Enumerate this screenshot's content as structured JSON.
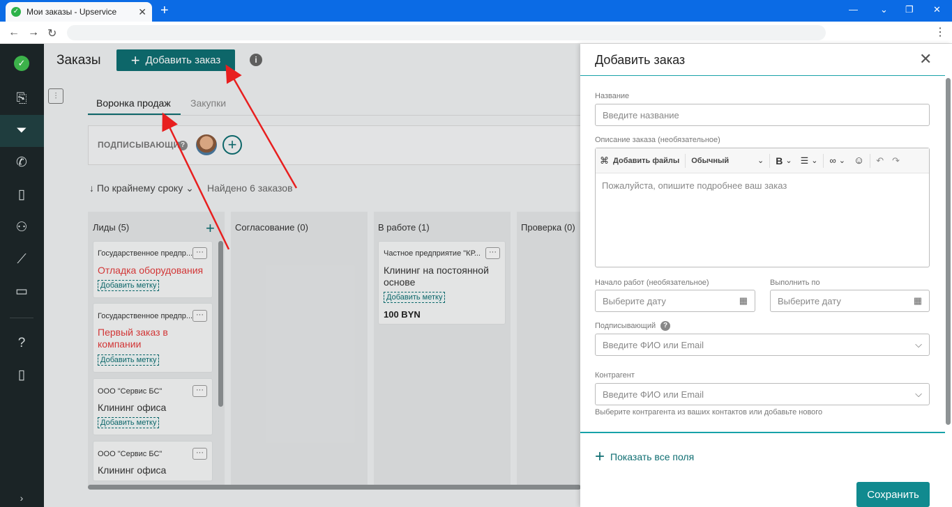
{
  "browser": {
    "tab_title": "Мои заказы - Upservice",
    "tab_close": "✕",
    "new_tab": "+",
    "minimize": "—",
    "maximize": "❐",
    "close": "✕",
    "back": "←",
    "forward": "→",
    "reload": "↻",
    "menu": "⋮"
  },
  "sidebar": {
    "icons": [
      "logo-icon",
      "clipboard-icon",
      "funnel-icon",
      "phone-icon",
      "book-icon",
      "users-icon",
      "chart-icon",
      "folder-icon",
      "help-icon",
      "tablet-icon",
      "expand-icon"
    ]
  },
  "header": {
    "title": "Заказы",
    "add_button": "Добавить заказ",
    "add_plus": "+",
    "info": "i"
  },
  "tabs": [
    {
      "label": "Воронка продаж",
      "active": true
    },
    {
      "label": "Закупки",
      "active": false
    }
  ],
  "signers": {
    "label": "ПОДПИСЫВАЮЩИЕ",
    "help": "?",
    "add": "+"
  },
  "sort": {
    "label": "По крайнему сроку",
    "icon": "↓",
    "chevron": "⌄"
  },
  "found": "Найдено 6 заказов",
  "columns": [
    {
      "title": "Лиды (5)",
      "add": "+"
    },
    {
      "title": "Согласование (0)"
    },
    {
      "title": "В работе (1)"
    },
    {
      "title": "Проверка (0)"
    }
  ],
  "cards": [
    {
      "org": "Государственное предпр...",
      "title": "Отладка оборудования",
      "tag": "Добавить метку",
      "dots": "···"
    },
    {
      "org": "Государственное предпр...",
      "title": "Первый заказ в компании",
      "tag": "Добавить метку",
      "dots": "···"
    },
    {
      "org": "ООО \"Сервис БС\"",
      "title": "Клининг офиса",
      "tag": "Добавить метку",
      "dots": "···"
    },
    {
      "org": "ООО \"Сервис БС\"",
      "title": "Клининг офиса",
      "tag": "",
      "dots": "···"
    },
    {
      "org": "Частное предприятие \"КР...",
      "title": "Клининг на постоянной основе",
      "tag": "Добавить метку",
      "price": "100 BYN",
      "dots": "···"
    }
  ],
  "drawer": {
    "title": "Добавить заказ",
    "close": "✕",
    "name_label": "Название",
    "name_placeholder": "Введите название",
    "desc_label": "Описание заказа (необязательное)",
    "toolbar": {
      "attach": "Добавить файлы",
      "style": "Обычный",
      "bold": "B",
      "chevron": "⌄",
      "list": "☰",
      "link": "🔗",
      "emoji": "☺",
      "undo": "↶",
      "redo": "↷"
    },
    "desc_placeholder": "Пожалуйста, опишите подробнее ваш заказ",
    "start_label": "Начало работ (необязательное)",
    "start_placeholder": "Выберите дату",
    "due_label": "Выполнить по",
    "due_placeholder": "Выберите дату",
    "calendar": "▦",
    "signer_label": "Подписывающий",
    "signer_help": "?",
    "signer_placeholder": "Введите ФИО или Email",
    "contractor_label": "Контрагент",
    "contractor_placeholder": "Введите ФИО или Email",
    "contractor_hint": "Выберите контрагента из ваших контактов или добавьте нового",
    "select_chevron": "⌵",
    "show_all_plus": "+",
    "show_all": "Показать все поля",
    "save": "Сохранить"
  },
  "colors": {
    "accent": "#0f6e72",
    "sidebar": "#1b2426",
    "browser": "#0b6be5",
    "red": "#e23b3b",
    "teal_line": "#17a2a8"
  }
}
